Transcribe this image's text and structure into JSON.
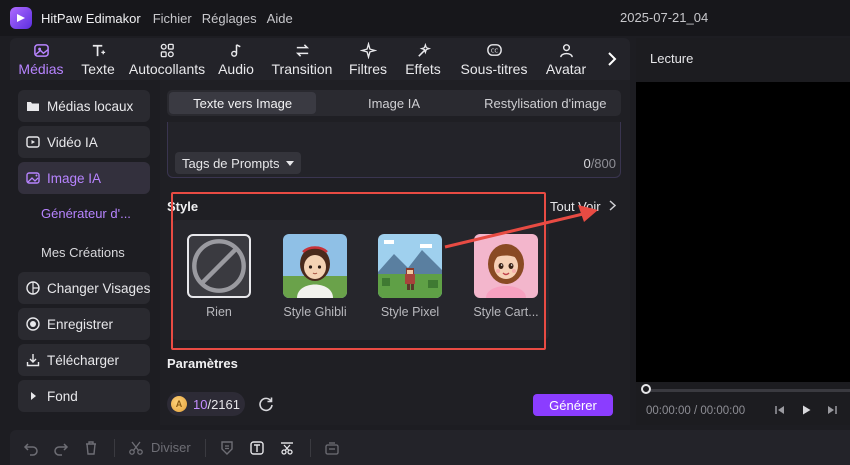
{
  "app": {
    "name": "HitPaw Edimakor",
    "menu": [
      "Fichier",
      "Réglages",
      "Aide"
    ],
    "project_name": "2025-07-21_04"
  },
  "toolbar": {
    "tabs": [
      {
        "label": "Médias",
        "icon": "media-icon",
        "active": true
      },
      {
        "label": "Texte",
        "icon": "text-icon"
      },
      {
        "label": "Autocollants",
        "icon": "stickers-icon"
      },
      {
        "label": "Audio",
        "icon": "music-note-icon"
      },
      {
        "label": "Transition",
        "icon": "transition-icon"
      },
      {
        "label": "Filtres",
        "icon": "filters-icon"
      },
      {
        "label": "Effets",
        "icon": "effects-icon"
      },
      {
        "label": "Sous-titres",
        "icon": "subtitles-icon"
      },
      {
        "label": "Avatar",
        "icon": "avatar-icon"
      }
    ],
    "next_icon": "chevron-right-icon"
  },
  "sidebar": {
    "items": [
      {
        "label": "Médias locaux",
        "icon": "folder-icon"
      },
      {
        "label": "Vidéo IA",
        "icon": "ai-video-icon"
      },
      {
        "label": "Image IA",
        "icon": "ai-image-icon",
        "active": true
      },
      {
        "label": "Générateur d'...",
        "sub": true,
        "active": true
      },
      {
        "label": "Mes Créations",
        "sub": true
      },
      {
        "label": "Changer Visages",
        "icon": "face-swap-icon"
      },
      {
        "label": "Enregistrer",
        "icon": "record-icon"
      },
      {
        "label": "Télécharger",
        "icon": "download-icon"
      },
      {
        "label": "Fond",
        "icon": "caret-right-icon"
      }
    ]
  },
  "generator": {
    "tabs": [
      "Texte vers Image",
      "Image IA",
      "Restylisation d'image"
    ],
    "active_tab": 0,
    "tags_button": "Tags de Prompts",
    "char_count_current": "0",
    "char_count_max": "/800",
    "style_title": "Style",
    "see_all": "Tout Voir",
    "styles": [
      {
        "label": "Rien",
        "icon": "none-icon",
        "selected": true
      },
      {
        "label": "Style Ghibli"
      },
      {
        "label": "Style Pixel"
      },
      {
        "label": "Style Cart..."
      }
    ],
    "params_title": "Paramètres",
    "credits_used": "10",
    "credits_total": "/2161",
    "generate_button": "Générer",
    "colors": {
      "accent": "#8b3dff",
      "accent_text": "#b784ff",
      "highlight": "#e84b43"
    }
  },
  "preview": {
    "title": "Lecture",
    "timecode": "00:00:00 / 00:00:00",
    "progress": 0
  },
  "bottombar": {
    "split_label": "Diviser",
    "icons": [
      "undo-icon",
      "redo-icon",
      "delete-icon",
      "scissors-icon",
      "shield-icon",
      "text-box-icon",
      "cut-tool-icon",
      "export-icon"
    ]
  }
}
